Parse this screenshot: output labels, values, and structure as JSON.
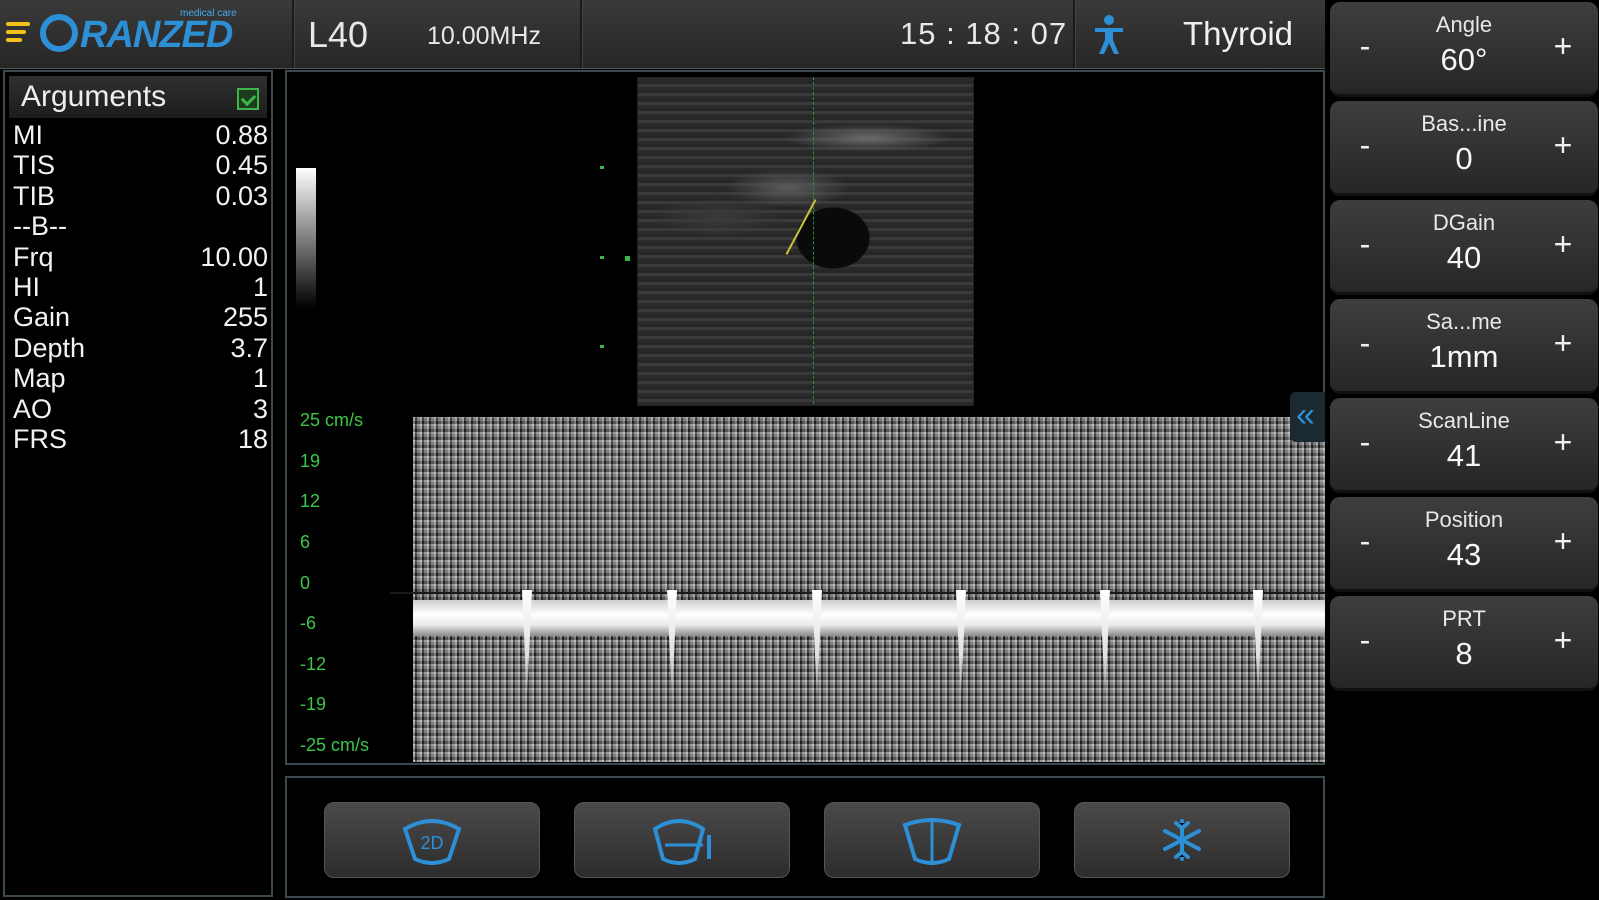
{
  "header": {
    "logo_text": "RANZED",
    "logo_sub": "medical care",
    "probe": "L40",
    "frequency": "10.00MHz",
    "time": "15 : 18 : 07",
    "preset": "Thyroid"
  },
  "arguments": {
    "title": "Arguments",
    "rows": [
      {
        "label": "MI",
        "value": "0.88"
      },
      {
        "label": "TIS",
        "value": "0.45"
      },
      {
        "label": "TIB",
        "value": "0.03"
      },
      {
        "label": "--B--",
        "value": ""
      },
      {
        "label": "Frq",
        "value": "10.00"
      },
      {
        "label": "HI",
        "value": "1"
      },
      {
        "label": "Gain",
        "value": "255"
      },
      {
        "label": "Depth",
        "value": "3.7"
      },
      {
        "label": "Map",
        "value": "1"
      },
      {
        "label": "AO",
        "value": "3"
      },
      {
        "label": "FRS",
        "value": "18"
      }
    ]
  },
  "velocity_axis": [
    "25 cm/s",
    "19",
    "12",
    "6",
    "0",
    "-6",
    "-12",
    "-19",
    "-25 cm/s"
  ],
  "controls": [
    {
      "label": "Angle",
      "value": "60°"
    },
    {
      "label": "Bas...ine",
      "value": "0"
    },
    {
      "label": "DGain",
      "value": "40"
    },
    {
      "label": "Sa...me",
      "value": "1mm"
    },
    {
      "label": "ScanLine",
      "value": "41"
    },
    {
      "label": "Position",
      "value": "43"
    },
    {
      "label": "PRT",
      "value": "8"
    }
  ],
  "control_signs": {
    "minus": "-",
    "plus": "+"
  },
  "mode_buttons": [
    "2d-mode-icon",
    "pw-mode-icon",
    "linear-mode-icon",
    "freeze-icon"
  ],
  "colors": {
    "accent": "#2d8fd6",
    "scale_green": "#3cc64a",
    "menu_yellow": "#f2c21b"
  }
}
